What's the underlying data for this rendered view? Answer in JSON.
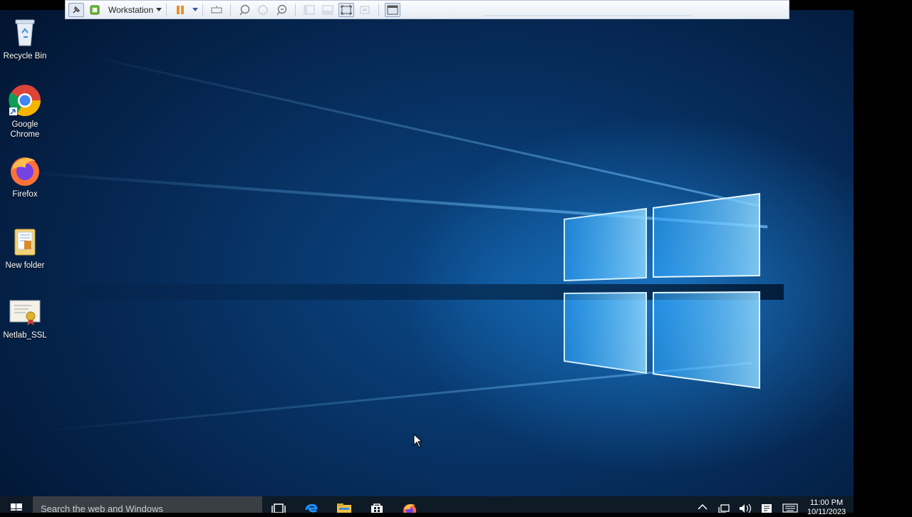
{
  "vm_toolbar": {
    "vm_name": "Workstation",
    "buttons": [
      "pin-icon",
      "vm-console-icon",
      "pause-icon",
      "send-keys-icon",
      "snapshot-icon",
      "revert-icon",
      "snapshot-manager-icon",
      "view-1-icon",
      "view-2-icon",
      "fit-guest-icon",
      "stretch-icon",
      "fullscreen-icon"
    ]
  },
  "desktop": {
    "icons": [
      {
        "label": "Recycle Bin",
        "icon": "recycle-bin-icon"
      },
      {
        "label": "Google Chrome",
        "icon": "chrome-icon"
      },
      {
        "label": "Firefox",
        "icon": "firefox-icon"
      },
      {
        "label": "New folder",
        "icon": "folder-icon"
      },
      {
        "label": "Netlab_SSL",
        "icon": "certificate-icon"
      }
    ]
  },
  "taskbar": {
    "search_placeholder": "Search the web and Windows",
    "apps": [
      "task-view-icon",
      "edge-icon",
      "file-explorer-icon",
      "store-icon",
      "firefox-icon"
    ],
    "time": "11:00 PM",
    "date": "10/11/2023"
  },
  "colors": {
    "toolbar_bg": "#eef2f7",
    "desktop_blue": "#0b4a8a",
    "taskbar_bg": "#0e1a26",
    "search_bg": "#3a3f45"
  }
}
